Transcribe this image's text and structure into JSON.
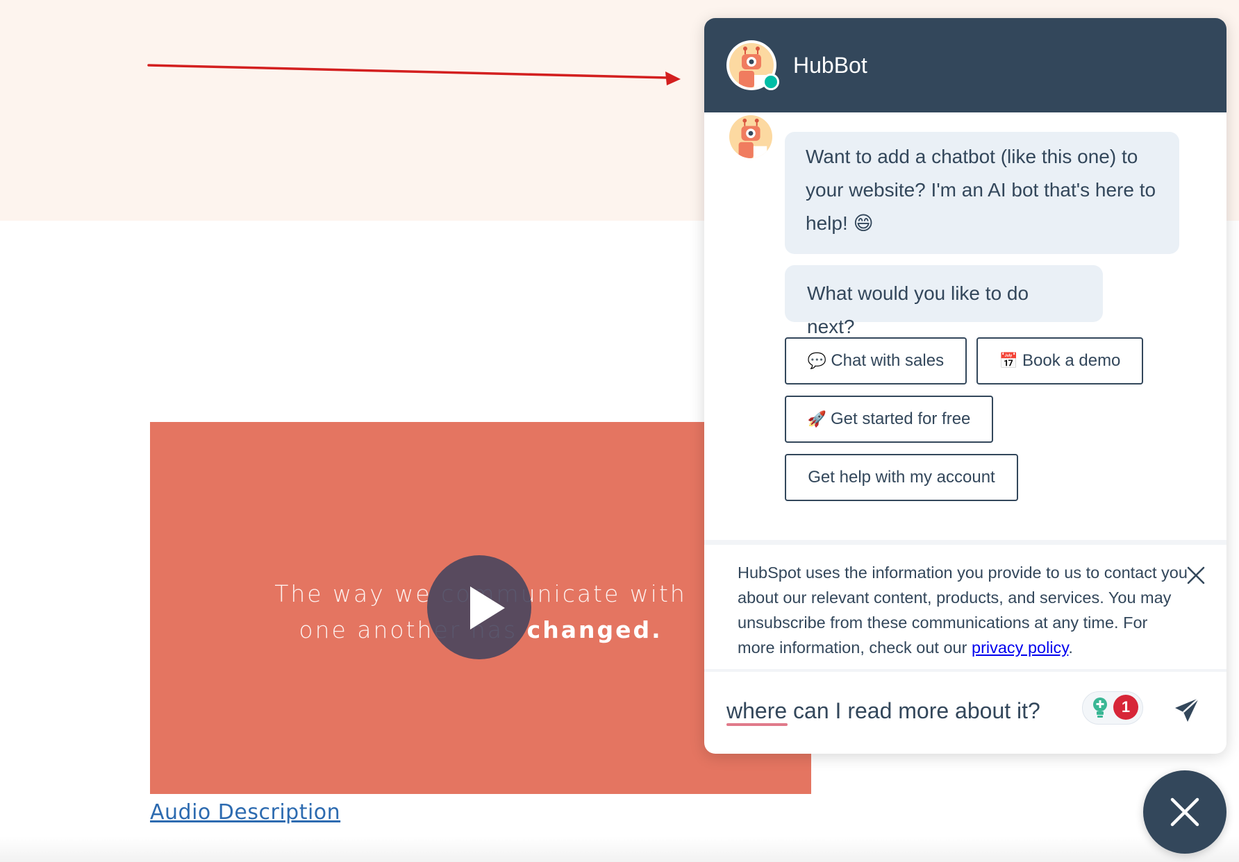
{
  "colors": {
    "hero_band": "#fdf4ee",
    "chat_header": "#33475b",
    "bubble": "#eaf0f6",
    "video": "#e47561",
    "annotation_arrow": "#d31f1f",
    "status_online": "#00bda5",
    "badge": "#d72638"
  },
  "video": {
    "caption_line1": "The way we communicate with",
    "caption_line2_regular": "one another has ",
    "caption_line2_bold": "changed.",
    "play_icon": "play-icon",
    "audio_description_link": "Audio Description"
  },
  "chat": {
    "title": "HubBot",
    "avatar_icon": "robot-avatar-icon",
    "messages": [
      "Want to add a chatbot (like this one) to your website? I'm an AI bot that's here to help! 😄",
      "What would you like to do next?"
    ],
    "quick_replies": {
      "sales": {
        "emoji": "💬",
        "label": "Chat with sales"
      },
      "demo": {
        "emoji": "📅",
        "label": "Book a demo"
      },
      "free": {
        "emoji": "🚀",
        "label": "Get started for free"
      },
      "help": {
        "label": "Get help with my account"
      }
    },
    "notice": {
      "text": "HubSpot uses the information you provide to us to contact you about our relevant content, products, and services. You may unsubscribe from these communications at any time. For more information, check out our ",
      "link": "privacy policy",
      "suffix": "."
    },
    "input": {
      "value": "where can I read more about it?"
    },
    "grammar_badge_count": "1"
  }
}
